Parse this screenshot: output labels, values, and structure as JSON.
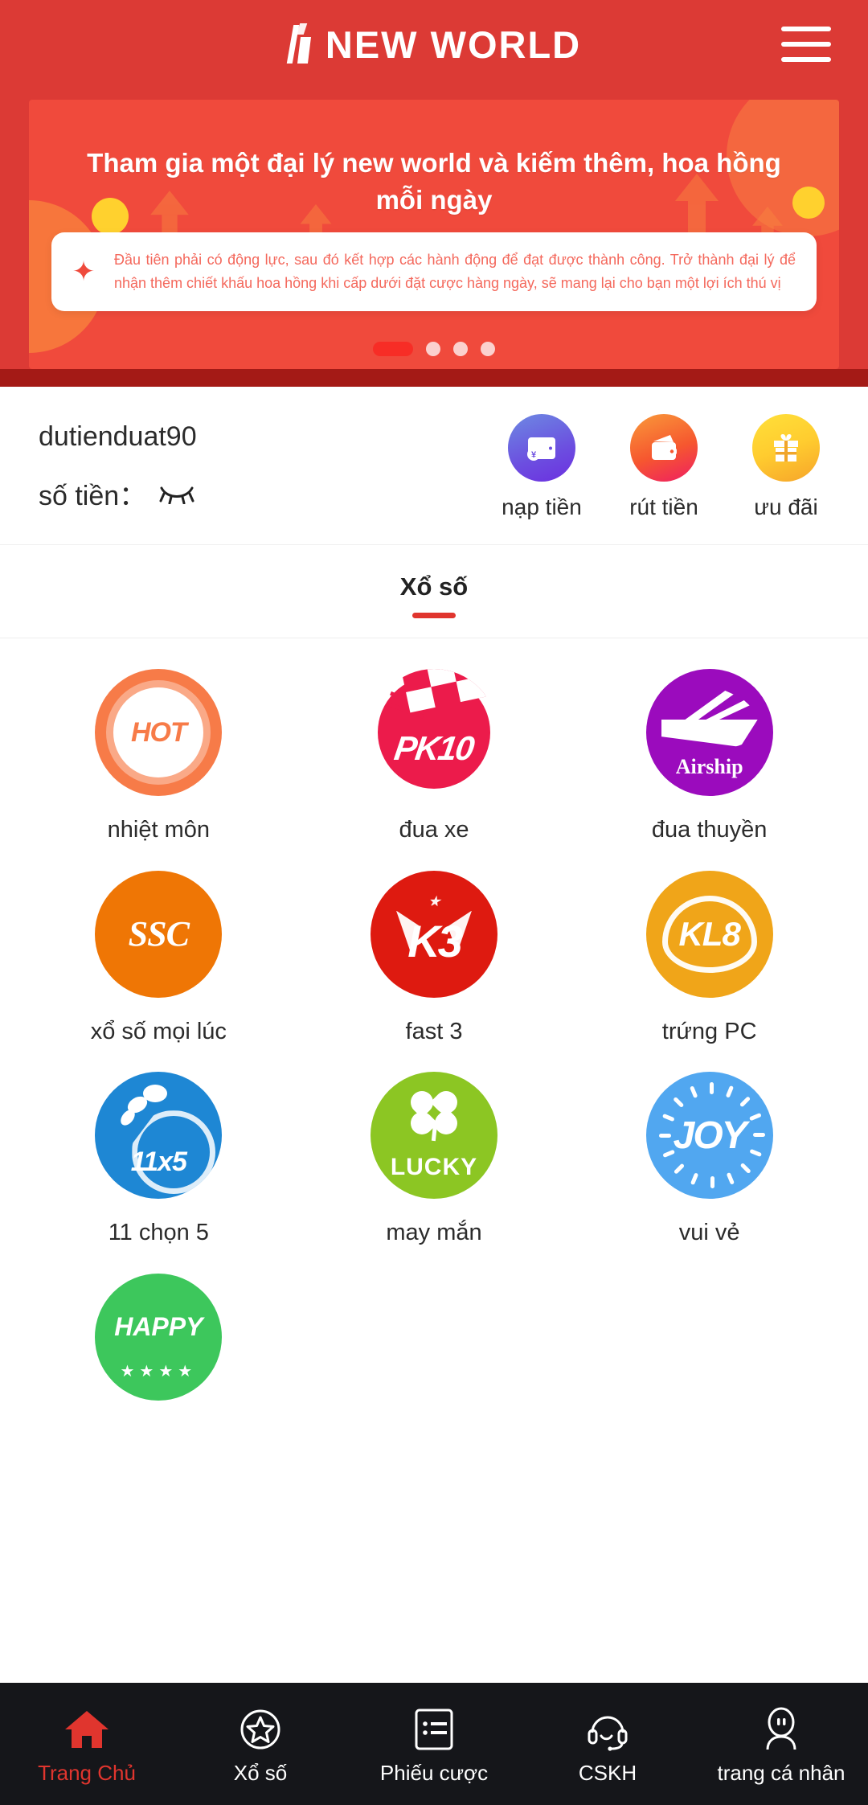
{
  "header": {
    "brand": "NEW WORLD",
    "logo_icon": "new-world-logo-icon",
    "menu_icon": "hamburger-menu-icon"
  },
  "banner": {
    "title": "Tham gia một đại lý new world và kiếm thêm, hoa hồng mỗi ngày",
    "card_icon": "star-icon",
    "card_text": "Đầu tiên phải có động lực, sau đó kết hợp các hành động để đạt được thành công. Trở thành đại lý để nhận thêm chiết khấu hoa hồng khi  cấp dưới đặt cược hàng ngày,  sẽ mang lại cho bạn một lợi ích thú vị",
    "dots_total": 4,
    "active_dot": 1
  },
  "account": {
    "username": "dutienduat90",
    "balance_label": "số tiền：",
    "balance_hidden_icon": "eye-off-icon",
    "actions": [
      {
        "label": "nạp tiền",
        "icon": "wallet-deposit-icon",
        "color": "#6c4ee0"
      },
      {
        "label": "rút tiền",
        "icon": "wallet-withdraw-icon",
        "color": "#f6572f"
      },
      {
        "label": "ưu đãi",
        "icon": "gift-icon",
        "color": "#ffcc2f"
      }
    ]
  },
  "section": {
    "title": "Xổ số",
    "accent_color": "#e0352e"
  },
  "games": [
    {
      "label": "nhiệt môn",
      "icon": "hot-flame-icon",
      "badge": "HOT",
      "color": "#f77b48"
    },
    {
      "label": "đua xe",
      "icon": "pk10-icon",
      "badge": "PK10",
      "color": "#ec1b4b"
    },
    {
      "label": "đua thuyền",
      "icon": "airship-icon",
      "badge": "Airship",
      "color": "#9b0bbd"
    },
    {
      "label": "xổ số mọi lúc",
      "icon": "ssc-icon",
      "badge": "SSC",
      "color": "#ef7605"
    },
    {
      "label": "fast 3",
      "icon": "k3-icon",
      "badge": "K3",
      "color": "#de1a10"
    },
    {
      "label": "trứng PC",
      "icon": "kl8-icon",
      "badge": "KL8",
      "color": "#f0a519"
    },
    {
      "label": "11 chọn 5",
      "icon": "eleven-x-five-icon",
      "badge": "11x5",
      "color": "#1e87d4"
    },
    {
      "label": "may mắn",
      "icon": "lucky-clover-icon",
      "badge": "LUCKY",
      "color": "#8cc623"
    },
    {
      "label": "vui vẻ",
      "icon": "joy-icon",
      "badge": "JOY",
      "color": "#51a7f0"
    },
    {
      "label": "",
      "icon": "happy-icon",
      "badge": "HAPPY",
      "color": "#3dc75c"
    }
  ],
  "tabbar": {
    "items": [
      {
        "label": "Trang Chủ",
        "icon": "home-icon",
        "active": true
      },
      {
        "label": "Xổ số",
        "icon": "star-circle-icon",
        "active": false
      },
      {
        "label": "Phiếu cược",
        "icon": "bet-list-icon",
        "active": false
      },
      {
        "label": "CSKH",
        "icon": "headset-icon",
        "active": false
      },
      {
        "label": "trang cá nhân",
        "icon": "person-icon",
        "active": false
      }
    ],
    "active_color": "#e0352e"
  }
}
